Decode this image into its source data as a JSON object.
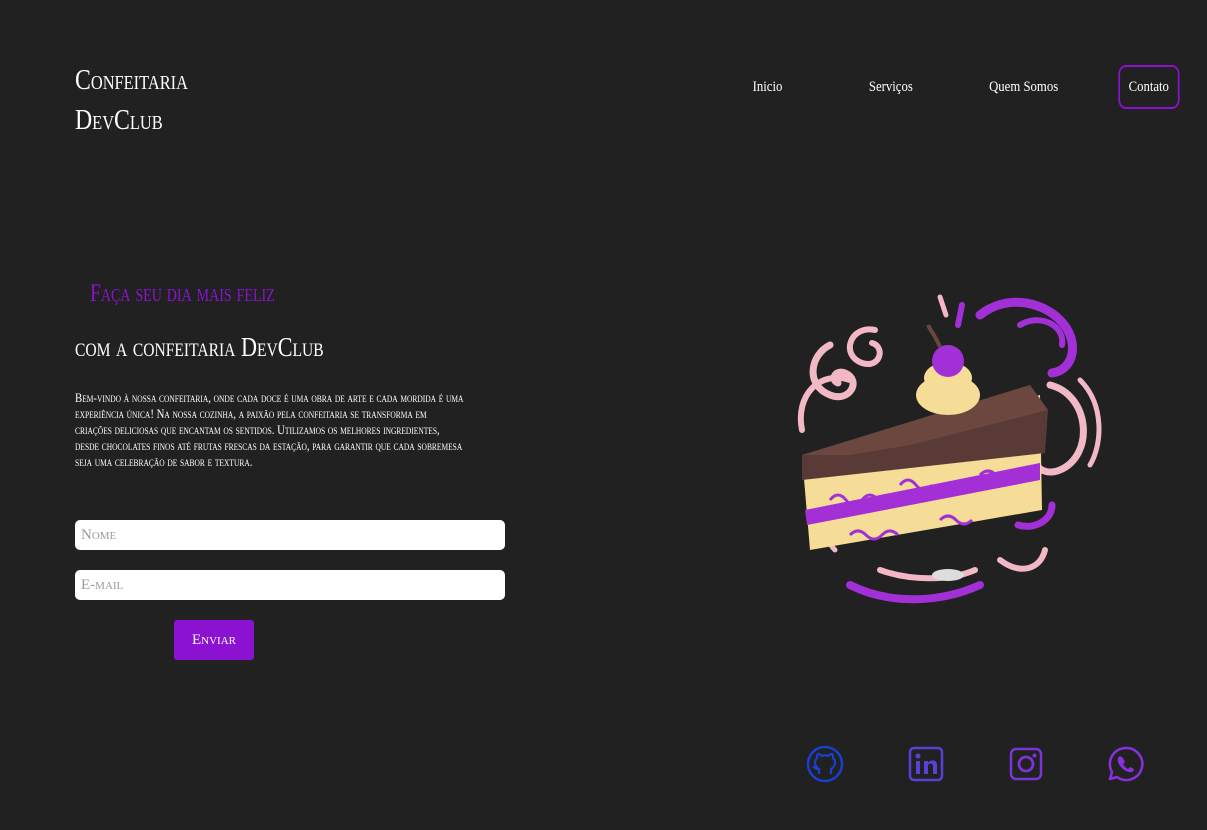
{
  "brand": {
    "line1": "Confeitaria",
    "line2": "DevClub"
  },
  "nav": {
    "items": [
      {
        "label": "Inicio"
      },
      {
        "label": "Serviços"
      },
      {
        "label": "Quem Somos"
      },
      {
        "label": "Contato"
      }
    ]
  },
  "hero": {
    "tagline": "Faça seu dia mais feliz",
    "headline": "com a confeitaria DevClub",
    "intro": "Bem-vindo à nossa confeitaria, onde cada doce é uma obra de arte e cada mordida é uma experiência única! Na nossa cozinha, a paixão pela confeitaria se transforma em criações deliciosas que encantam os sentidos. Utilizamos os melhores ingredientes, desde chocolates finos até frutas frescas da estação, para garantir que cada sobremesa seja uma celebração de sabor e textura."
  },
  "form": {
    "name_placeholder": "Nome",
    "email_placeholder": "E-mail",
    "submit_label": "Enviar"
  },
  "social": [
    {
      "icon": "github-icon",
      "color": "#1a3fd0"
    },
    {
      "icon": "linkedin-icon",
      "color": "#5b3fd8"
    },
    {
      "icon": "instagram-icon",
      "color": "#7b35d6"
    },
    {
      "icon": "whatsapp-icon",
      "color": "#8a2fe0"
    }
  ],
  "colors": {
    "background": "#212121",
    "accent": "#8a12d0",
    "text": "#ffffff"
  }
}
